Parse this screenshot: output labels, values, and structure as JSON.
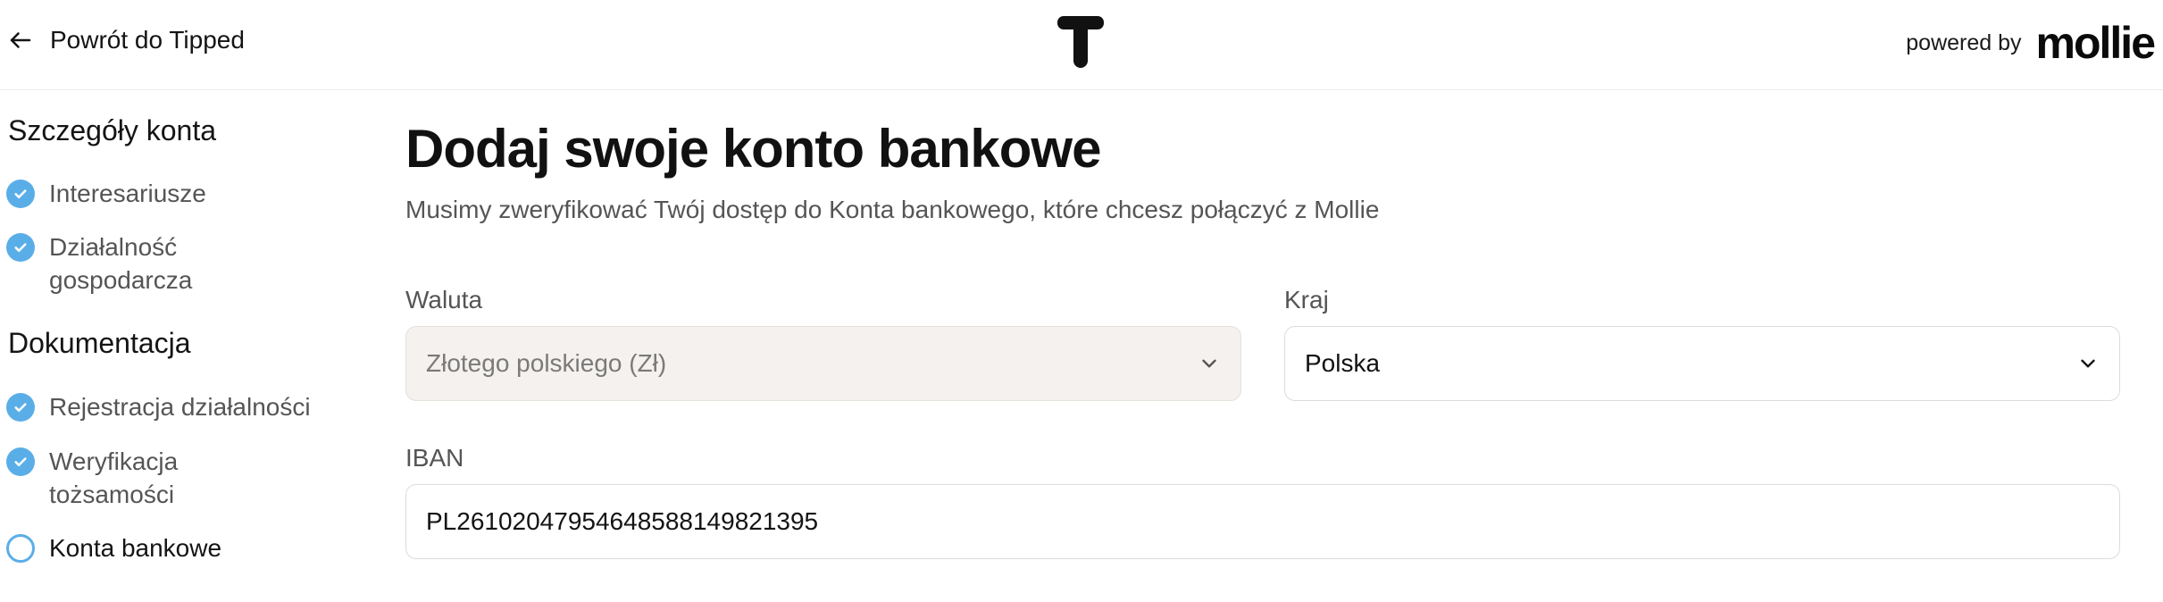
{
  "header": {
    "back_label": "Powrót do Tipped",
    "brand_logo": "T",
    "powered_by": "powered by",
    "provider_logo": "mollie"
  },
  "sidebar": {
    "sections": [
      {
        "title": "Szczegóły konta",
        "items": [
          {
            "label": "Interesariusze",
            "status": "done"
          },
          {
            "label": "Działalność gospodarcza",
            "status": "done"
          }
        ]
      },
      {
        "title": "Dokumentacja",
        "items": [
          {
            "label": "Rejestracja działalności",
            "status": "done"
          },
          {
            "label": "Weryfikacja tożsamości",
            "status": "done"
          },
          {
            "label": "Konta bankowe",
            "status": "current"
          }
        ]
      }
    ]
  },
  "main": {
    "title": "Dodaj swoje konto bankowe",
    "subtitle": "Musimy zweryfikować Twój dostęp do Konta bankowego, które chcesz połączyć z Mollie",
    "currency": {
      "label": "Waluta",
      "value": "Złotego polskiego (Zł)",
      "disabled": true
    },
    "country": {
      "label": "Kraj",
      "value": "Polska"
    },
    "iban": {
      "label": "IBAN",
      "value": "PL26102047954648588149821395"
    }
  },
  "colors": {
    "accent": "#5aaee8",
    "disabled_bg": "#f4f1ee"
  }
}
